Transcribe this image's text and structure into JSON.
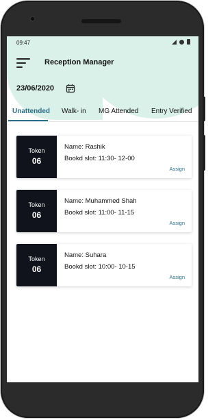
{
  "status_bar": {
    "time": "09:47"
  },
  "app_bar": {
    "title": "Reception Manager"
  },
  "date": {
    "value": "23/06/2020"
  },
  "tabs": [
    {
      "label": "Unattended",
      "active": true
    },
    {
      "label": "Walk- in",
      "active": false
    },
    {
      "label": "MG Attended",
      "active": false
    },
    {
      "label": "Entry Verified",
      "active": false
    }
  ],
  "cards": [
    {
      "token_label": "Token",
      "token_number": "06",
      "name_label": "Name:",
      "name": "Rashik",
      "slot_label": "Bookd slot:",
      "slot": "11:30- 12-00",
      "action": "Assign"
    },
    {
      "token_label": "Token",
      "token_number": "06",
      "name_label": "Name:",
      "name": "Muhammed Shah",
      "slot_label": "Bookd slot:",
      "slot": "11:00- 11-15",
      "action": "Assign"
    },
    {
      "token_label": "Token",
      "token_number": "06",
      "name_label": "Name:",
      "name": "Suhara",
      "slot_label": "Bookd slot:",
      "slot": "10:00- 10-15",
      "action": "Assign"
    }
  ],
  "colors": {
    "accent": "#2a6f8a",
    "header_tint": "#d9f1e9",
    "token_bg": "#10131c"
  },
  "icons": {
    "menu": "hamburger-menu-icon",
    "calendar": "calendar-icon"
  }
}
